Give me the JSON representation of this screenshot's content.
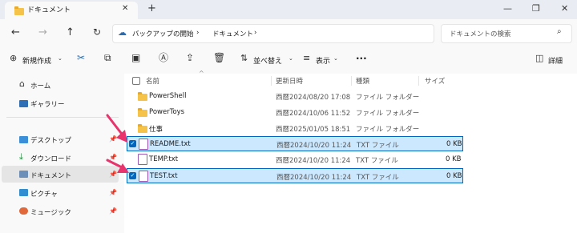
{
  "window": {
    "tab_title": "ドキュメント",
    "new_tab": "+",
    "controls": {
      "minimize": "—",
      "maximize": "❐",
      "close": "✕"
    }
  },
  "address": {
    "root": "バックアップの開始",
    "separator": "›",
    "current": "ドキュメント",
    "search_placeholder": "ドキュメントの検索"
  },
  "toolbar": {
    "new_label": "新規作成",
    "sort_label": "並べ替え",
    "view_label": "表示",
    "more_label": "···",
    "details_label": "詳細"
  },
  "nav": {
    "home": "ホーム",
    "gallery": "ギャラリー",
    "pinned": [
      {
        "label": "デスクトップ"
      },
      {
        "label": "ダウンロード"
      },
      {
        "label": "ドキュメント"
      },
      {
        "label": "ピクチャ"
      },
      {
        "label": "ミュージック"
      }
    ]
  },
  "columns": {
    "name": "名前",
    "modified": "更新日時",
    "type": "種類",
    "size": "サイズ"
  },
  "files": [
    {
      "name": "PowerShell",
      "modified": "西暦2024/08/20 17:08",
      "type": "ファイル フォルダー",
      "size": "",
      "kind": "folder",
      "selected": false
    },
    {
      "name": "PowerToys",
      "modified": "西暦2024/10/06 11:52",
      "type": "ファイル フォルダー",
      "size": "",
      "kind": "folder",
      "selected": false
    },
    {
      "name": "仕事",
      "modified": "西暦2025/01/05 18:51",
      "type": "ファイル フォルダー",
      "size": "",
      "kind": "folder",
      "selected": false
    },
    {
      "name": "README.txt",
      "modified": "西暦2024/10/20 11:24",
      "type": "TXT ファイル",
      "size": "0 KB",
      "kind": "txt",
      "selected": true
    },
    {
      "name": "TEMP.txt",
      "modified": "西暦2024/10/20 11:24",
      "type": "TXT ファイル",
      "size": "0 KB",
      "kind": "txt",
      "selected": false
    },
    {
      "name": "TEST.txt",
      "modified": "西暦2024/10/20 11:24",
      "type": "TXT ファイル",
      "size": "0 KB",
      "kind": "txt",
      "selected": true
    }
  ],
  "colors": {
    "accent": "#0067c0",
    "selection": "#cce8ff",
    "annotation": "#e8336d"
  }
}
